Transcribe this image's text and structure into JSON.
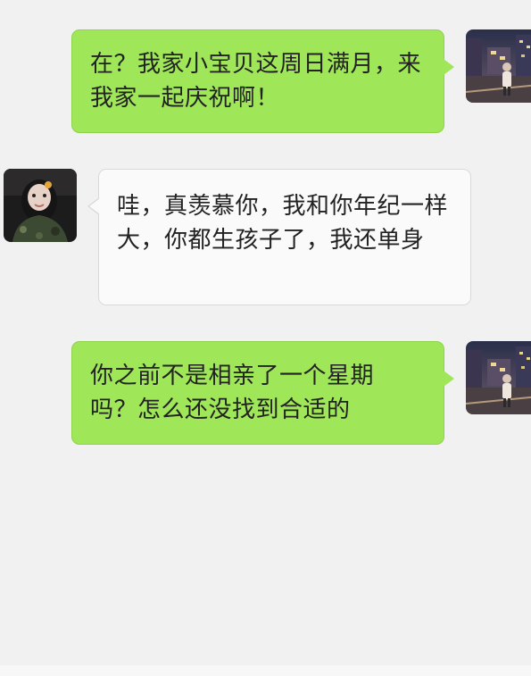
{
  "chat": {
    "messages": [
      {
        "sender": "me",
        "text": "在？我家小宝贝这周日满月，来我家一起庆祝啊！"
      },
      {
        "sender": "friend",
        "text": "哇，真羡慕你，我和你年纪一样大，你都生孩子了，我还单身"
      },
      {
        "sender": "me",
        "text": "你之前不是相亲了一个星期吗？怎么还没找到合适的"
      }
    ]
  },
  "colors": {
    "background": "#f1f1f1",
    "sent_bubble": "#9fe658",
    "received_bubble": "#fafafa",
    "text": "#222222"
  }
}
